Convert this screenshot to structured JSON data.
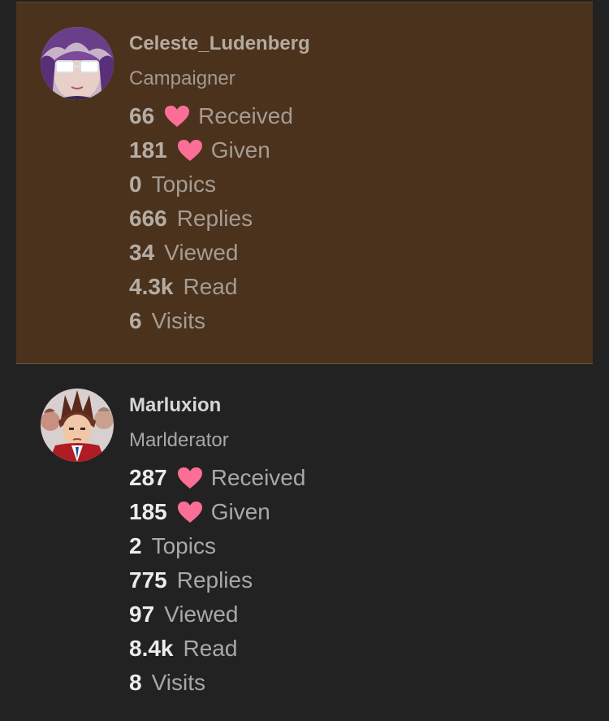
{
  "colors": {
    "page_bg": "#222222",
    "highlight_bg": "#4b321c",
    "heart": "#fb6f96"
  },
  "users": [
    {
      "username": "Celeste_Ludenberg",
      "title": "Campaigner",
      "avatar_icon": "purple-haired-glasses-avatar",
      "stats": {
        "received": {
          "value": "66",
          "label": "Received"
        },
        "given": {
          "value": "181",
          "label": "Given"
        },
        "topics": {
          "value": "0",
          "label": "Topics"
        },
        "replies": {
          "value": "666",
          "label": "Replies"
        },
        "viewed": {
          "value": "34",
          "label": "Viewed"
        },
        "read": {
          "value": "4.3k",
          "label": "Read"
        },
        "visits": {
          "value": "6",
          "label": "Visits"
        }
      }
    },
    {
      "username": "Marluxion",
      "title": "Marlderator",
      "avatar_icon": "spiky-haired-lawyer-avatar",
      "stats": {
        "received": {
          "value": "287",
          "label": "Received"
        },
        "given": {
          "value": "185",
          "label": "Given"
        },
        "topics": {
          "value": "2",
          "label": "Topics"
        },
        "replies": {
          "value": "775",
          "label": "Replies"
        },
        "viewed": {
          "value": "97",
          "label": "Viewed"
        },
        "read": {
          "value": "8.4k",
          "label": "Read"
        },
        "visits": {
          "value": "8",
          "label": "Visits"
        }
      }
    }
  ]
}
